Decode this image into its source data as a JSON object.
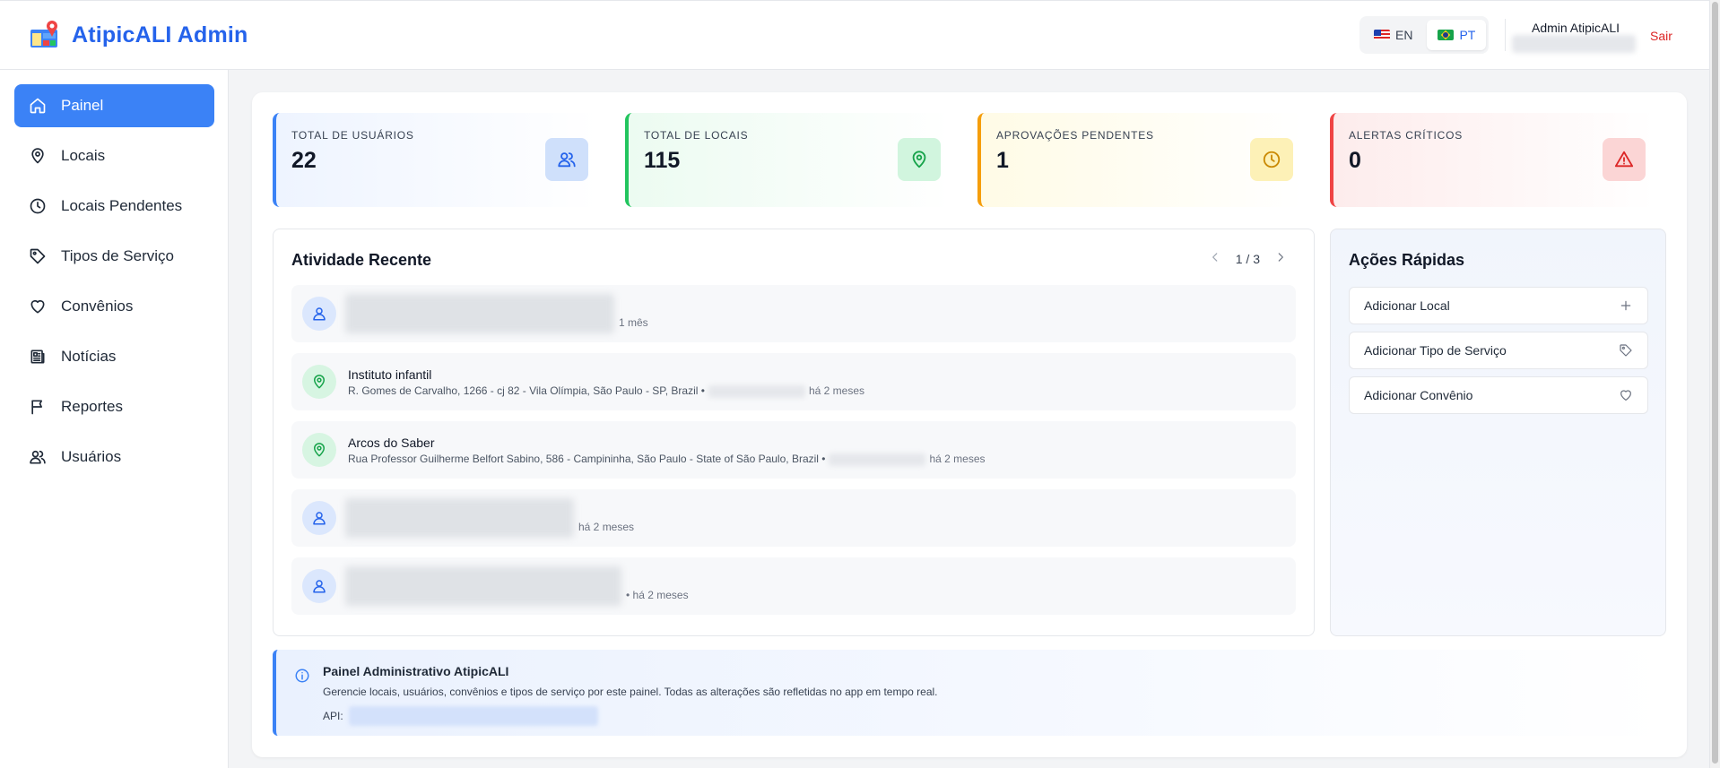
{
  "header": {
    "brand_title": "AtipicALI Admin",
    "languages": [
      {
        "code": "EN",
        "active": false
      },
      {
        "code": "PT",
        "active": true
      }
    ],
    "user_name": "Admin AtipicALI",
    "logout_label": "Sair"
  },
  "sidebar": {
    "items": [
      {
        "label": "Painel",
        "icon": "home-icon",
        "active": true
      },
      {
        "label": "Locais",
        "icon": "map-pin-icon",
        "active": false
      },
      {
        "label": "Locais Pendentes",
        "icon": "clock-icon",
        "active": false
      },
      {
        "label": "Tipos de Serviço",
        "icon": "tag-icon",
        "active": false
      },
      {
        "label": "Convênios",
        "icon": "heart-icon",
        "active": false
      },
      {
        "label": "Notícias",
        "icon": "newspaper-icon",
        "active": false
      },
      {
        "label": "Reportes",
        "icon": "flag-icon",
        "active": false
      },
      {
        "label": "Usuários",
        "icon": "users-icon",
        "active": false
      }
    ]
  },
  "stats": [
    {
      "label": "TOTAL DE USUÁRIOS",
      "value": "22",
      "icon": "users-icon",
      "color": "#3b82f6"
    },
    {
      "label": "TOTAL DE LOCAIS",
      "value": "115",
      "icon": "map-pin-icon",
      "color": "#22c55e"
    },
    {
      "label": "APROVAÇÕES PENDENTES",
      "value": "1",
      "icon": "clock-icon",
      "color": "#f59e0b"
    },
    {
      "label": "ALERTAS CRÍTICOS",
      "value": "0",
      "icon": "alert-triangle-icon",
      "color": "#ef4444"
    }
  ],
  "activity": {
    "title": "Atividade Recente",
    "page_label": "1 / 3",
    "items": [
      {
        "type": "user",
        "name": "",
        "detail": "",
        "time": "1 mês"
      },
      {
        "type": "place",
        "name": "Instituto infantil",
        "detail": "R. Gomes de Carvalho, 1266 - cj 82 - Vila Olímpia, São Paulo - SP, Brazil •",
        "time": "há 2 meses"
      },
      {
        "type": "place",
        "name": "Arcos do Saber",
        "detail": "Rua Professor Guilherme Belfort Sabino, 586 - Campininha, São Paulo - State of São Paulo, Brazil •",
        "time": "há 2 meses"
      },
      {
        "type": "user",
        "name": "",
        "detail": "",
        "time": "há 2 meses"
      },
      {
        "type": "user",
        "name": "",
        "detail": "",
        "time": "• há 2 meses"
      }
    ]
  },
  "quick_actions": {
    "title": "Ações Rápidas",
    "items": [
      {
        "label": "Adicionar Local",
        "icon": "plus-icon"
      },
      {
        "label": "Adicionar Tipo de Serviço",
        "icon": "tag-icon"
      },
      {
        "label": "Adicionar Convênio",
        "icon": "heart-icon"
      }
    ]
  },
  "info": {
    "title": "Painel Administrativo AtipicALI",
    "text": "Gerencie locais, usuários, convênios e tipos de serviço por este painel. Todas as alterações são refletidas no app em tempo real.",
    "api_label": "API:"
  },
  "colors": {
    "accent": "#3b82f6",
    "brand": "#2563eb",
    "logout": "#dc2626"
  }
}
